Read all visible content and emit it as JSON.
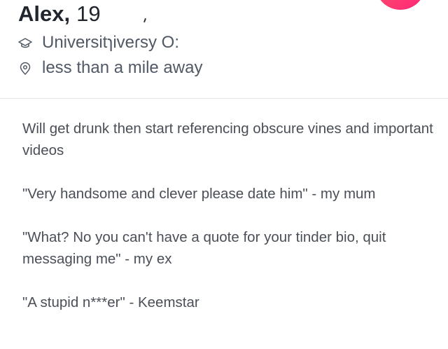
{
  "profile": {
    "name": "Alex",
    "name_separator": ",",
    "age": "19",
    "school": "Universitɿiveɾsy O:",
    "distance": "less than a mile away"
  },
  "bio": {
    "lines": [
      "Will get drunk then start referencing obscure vines and important videos",
      "\"Very handsome and clever please date him\" - my mum",
      "\"What? No you can't have a quote for your tinder bio, quit messaging me\" - my ex",
      "\"A stupid n***er\" - Keemstar"
    ]
  },
  "icons": {
    "school": "graduation-cap-icon",
    "distance": "location-pin-icon"
  },
  "colors": {
    "accent_gradient_start": "#ff5864",
    "accent_gradient_end": "#fd267a"
  }
}
